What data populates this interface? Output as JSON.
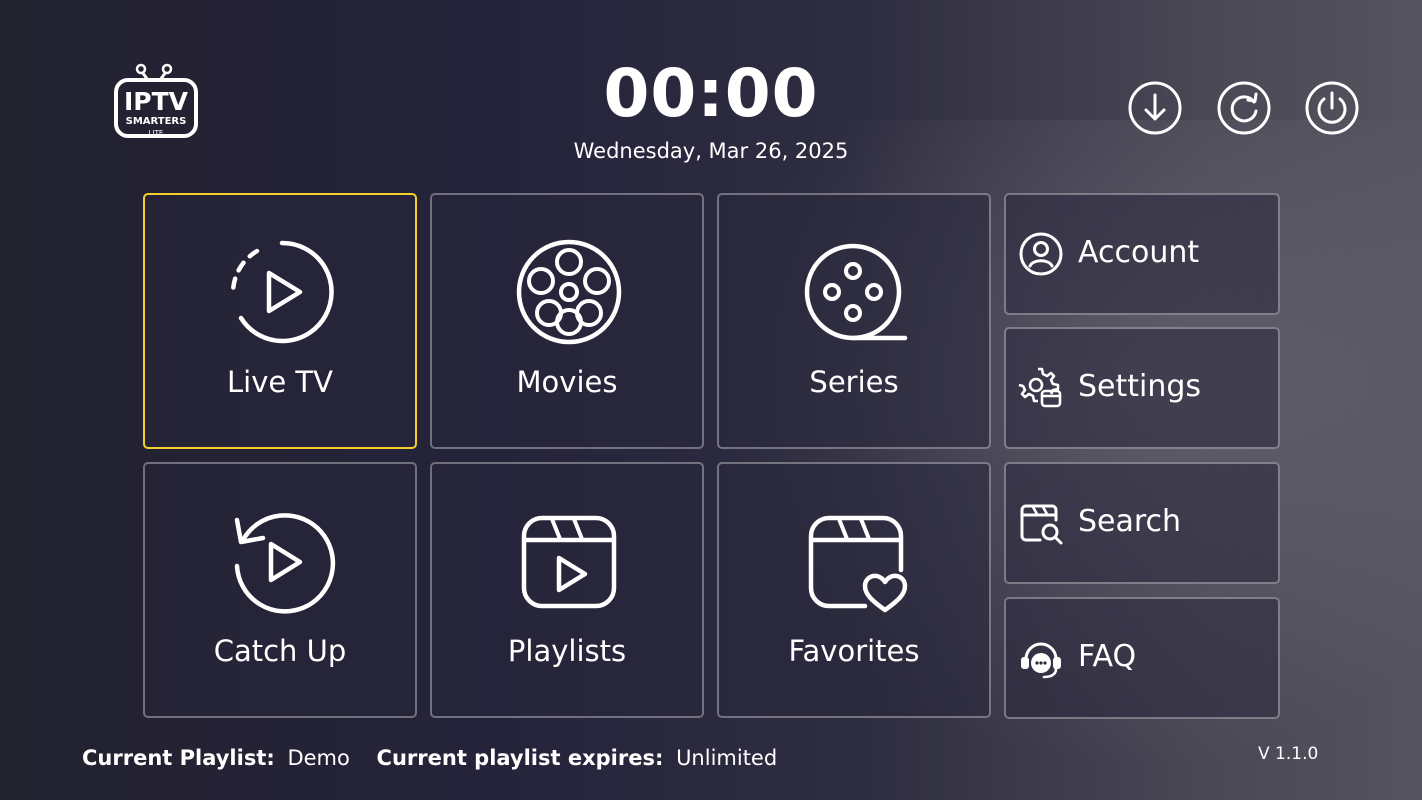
{
  "app": {
    "logo_text": "IPTV",
    "logo_sub": "SMARTERS",
    "logo_sub2": "LITE"
  },
  "header": {
    "time": "00:00",
    "date": "Wednesday, Mar 26, 2025"
  },
  "top_actions": [
    {
      "icon": "download-icon"
    },
    {
      "icon": "refresh-icon"
    },
    {
      "icon": "power-icon"
    }
  ],
  "tiles": [
    {
      "label": "Live TV",
      "icon": "live-tv-icon",
      "selected": true
    },
    {
      "label": "Movies",
      "icon": "film-reel-icon",
      "selected": false
    },
    {
      "label": "Series",
      "icon": "series-reel-icon",
      "selected": false
    },
    {
      "label": "Catch Up",
      "icon": "catch-up-icon",
      "selected": false
    },
    {
      "label": "Playlists",
      "icon": "playlist-icon",
      "selected": false
    },
    {
      "label": "Favorites",
      "icon": "favorites-icon",
      "selected": false
    }
  ],
  "side_menu": [
    {
      "label": "Account",
      "icon": "account-icon"
    },
    {
      "label": "Settings",
      "icon": "settings-icon"
    },
    {
      "label": "Search",
      "icon": "search-icon"
    },
    {
      "label": "FAQ",
      "icon": "faq-icon"
    }
  ],
  "footer": {
    "playlist_label": "Current Playlist:",
    "playlist_value": "Demo",
    "expires_label": "Current playlist expires:",
    "expires_value": "Unlimited"
  },
  "version": "V 1.1.0",
  "colors": {
    "selected_border": "#f2cf2c",
    "tile_border": "rgba(255,255,255,0.35)",
    "background": "#23222f"
  }
}
